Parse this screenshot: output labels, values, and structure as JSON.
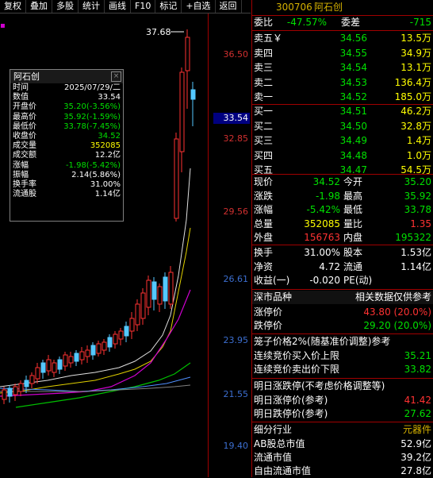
{
  "toolbar": [
    "复权",
    "叠加",
    "多股",
    "统计",
    "画线",
    "F10",
    "标记",
    "+自选",
    "返回"
  ],
  "chart": {
    "price_ticks": [
      "36.50",
      "32.85",
      "29.56",
      "26.61",
      "23.95",
      "21.55",
      "19.40"
    ],
    "current_price_tag": "33.54",
    "high_marker": "37.68"
  },
  "info_box": {
    "title": "阿石创",
    "rows": [
      {
        "label": "时间",
        "value": "2025/07/29/二",
        "color": "#ffffff"
      },
      {
        "label": "数值",
        "value": "33.54",
        "color": "#ffffff"
      },
      {
        "label": "开盘价",
        "value": "35.20(-3.56%)",
        "color": "#00e000"
      },
      {
        "label": "最高价",
        "value": "35.92(-1.59%)",
        "color": "#00e000"
      },
      {
        "label": "最低价",
        "value": "33.78(-7.45%)",
        "color": "#00e000"
      },
      {
        "label": "收盘价",
        "value": "34.52",
        "color": "#00e000"
      },
      {
        "label": "成交量",
        "value": "352085",
        "color": "#ffff00"
      },
      {
        "label": "成交额",
        "value": "12.2亿",
        "color": "#ffffff"
      },
      {
        "label": "涨幅",
        "value": "-1.98(-5.42%)",
        "color": "#00e000"
      },
      {
        "label": "振幅",
        "value": "2.14(5.86%)",
        "color": "#ffffff"
      },
      {
        "label": "换手率",
        "value": "31.00%",
        "color": "#ffffff"
      },
      {
        "label": "流通股",
        "value": "1.14亿",
        "color": "#ffffff"
      }
    ]
  },
  "quote": {
    "code": "300706",
    "name": "阿石创",
    "weibi_label": "委比",
    "weibi": "-47.57%",
    "weicha_label": "委差",
    "weicha": "-715",
    "sells": [
      {
        "label": "卖五￥",
        "price": "34.56",
        "vol": "13.5万"
      },
      {
        "label": "卖四",
        "price": "34.55",
        "vol": "34.9万"
      },
      {
        "label": "卖三",
        "price": "34.54",
        "vol": "13.1万"
      },
      {
        "label": "卖二",
        "price": "34.53",
        "vol": "136.4万"
      },
      {
        "label": "卖一",
        "price": "34.52",
        "vol": "185.0万"
      }
    ],
    "buys": [
      {
        "label": "买一",
        "price": "34.51",
        "vol": "46.2万"
      },
      {
        "label": "买二",
        "price": "34.50",
        "vol": "32.8万"
      },
      {
        "label": "买三",
        "price": "34.49",
        "vol": "1.4万"
      },
      {
        "label": "买四",
        "price": "34.48",
        "vol": "1.0万"
      },
      {
        "label": "买五",
        "price": "34.47",
        "vol": "54.5万"
      }
    ],
    "stats": [
      {
        "l1": "现价",
        "v1": "34.52",
        "c1": "#00e000",
        "l2": "今开",
        "v2": "35.20",
        "c2": "#00e000"
      },
      {
        "l1": "涨跌",
        "v1": "-1.98",
        "c1": "#00e000",
        "l2": "最高",
        "v2": "35.92",
        "c2": "#00e000"
      },
      {
        "l1": "涨幅",
        "v1": "-5.42%",
        "c1": "#00e000",
        "l2": "最低",
        "v2": "33.78",
        "c2": "#00e000"
      },
      {
        "l1": "总量",
        "v1": "352085",
        "c1": "#ffff00",
        "l2": "量比",
        "v2": "1.35",
        "c2": "#ff3232"
      },
      {
        "l1": "外盘",
        "v1": "156763",
        "c1": "#ff3232",
        "l2": "内盘",
        "v2": "195322",
        "c2": "#00e000"
      }
    ],
    "stats2": [
      {
        "l1": "换手",
        "v1": "31.00%",
        "c1": "#ffffff",
        "l2": "股本",
        "v2": "1.53亿",
        "c2": "#ffffff"
      },
      {
        "l1": "净资",
        "v1": "4.72",
        "c1": "#ffffff",
        "l2": "流通",
        "v2": "1.14亿",
        "c2": "#ffffff"
      },
      {
        "l1": "收益(一)",
        "v1": "-0.020",
        "c1": "#ffffff",
        "l2": "PE(动)",
        "v2": "",
        "c2": "#ffffff"
      }
    ],
    "market_label": "深市品种",
    "market_note": "相关数据仅供参考",
    "limit_up_label": "涨停价",
    "limit_up": "43.80 (20.0%)",
    "limit_down_label": "跌停价",
    "limit_down": "29.20 (20.0%)",
    "cage_title": "笼子价格2%(随基准价调整)参考",
    "cage_buy_label": "连续竞价买入价上限",
    "cage_buy": "35.21",
    "cage_sell_label": "连续竞价卖出价下限",
    "cage_sell": "33.82",
    "tomorrow_title": "明日涨跌停(不考虑价格调整等)",
    "tomorrow_up_label": "明日涨停价(参考)",
    "tomorrow_up": "41.42",
    "tomorrow_down_label": "明日跌停价(参考)",
    "tomorrow_down": "27.62",
    "industry_label": "细分行业",
    "industry": "元器件",
    "cap_rows": [
      {
        "label": "AB股总市值",
        "value": "52.9亿"
      },
      {
        "label": "流通市值",
        "value": "39.2亿"
      },
      {
        "label": "自由流通市值",
        "value": "27.8亿"
      }
    ]
  },
  "colors": {
    "up": "#ff3232",
    "down": "#54c8ff",
    "axis": "#a00000"
  }
}
